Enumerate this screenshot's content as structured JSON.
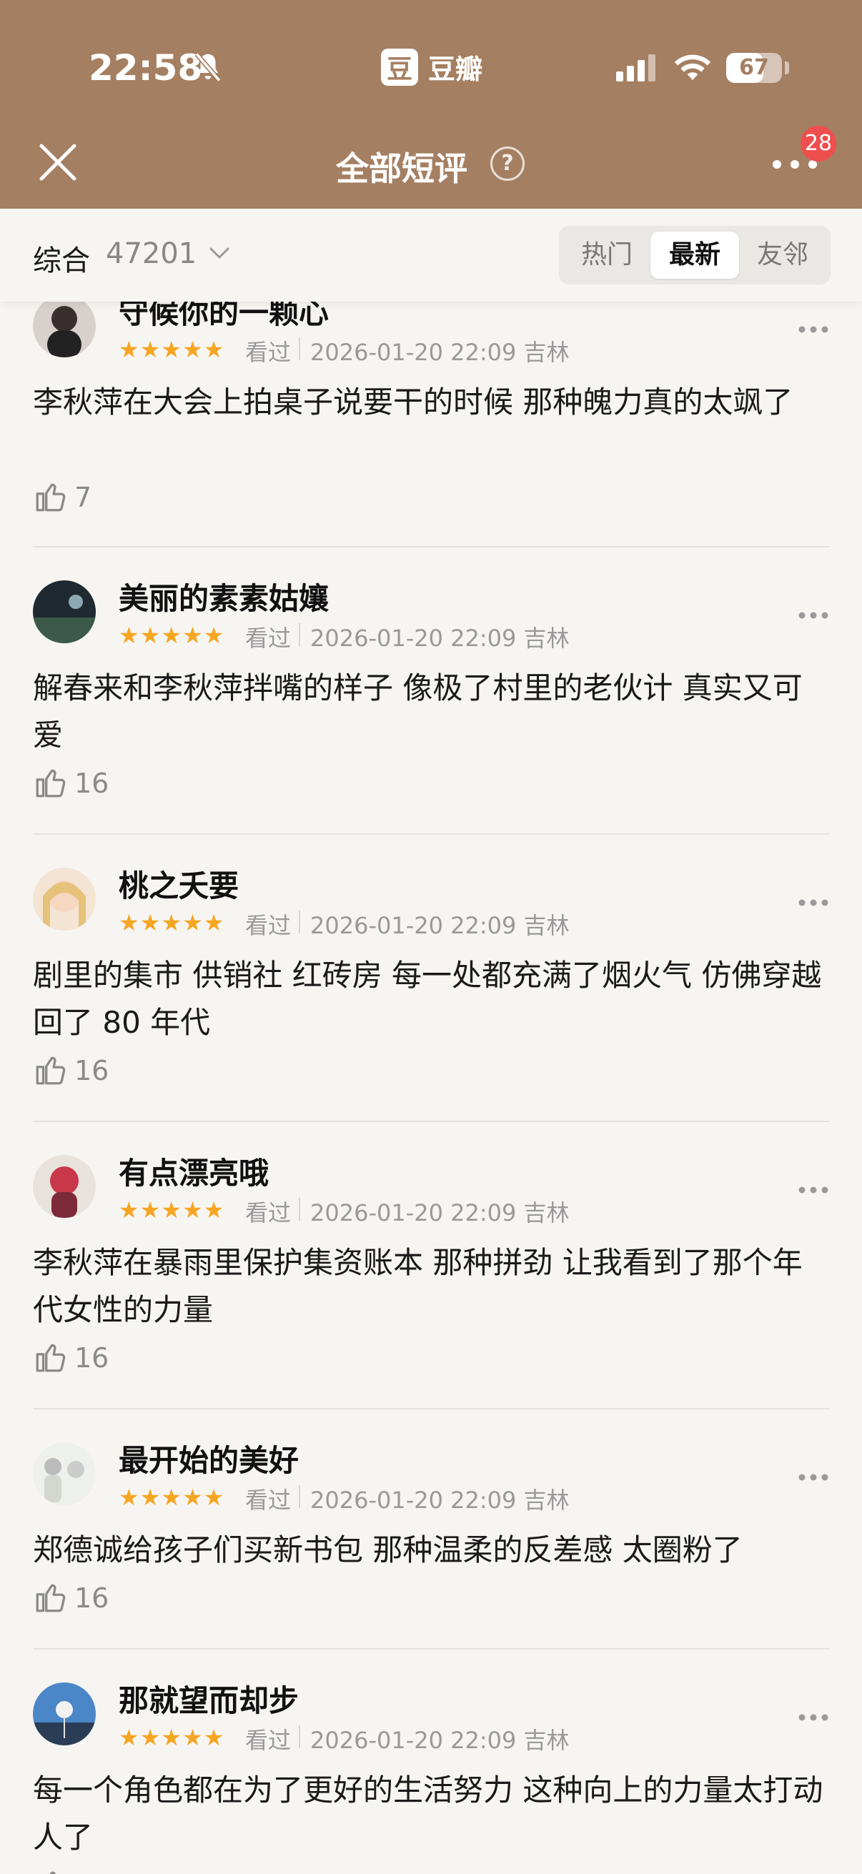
{
  "status_bar": {
    "time": "22:58",
    "battery": "67",
    "battery_level": 0.67
  },
  "app": {
    "brand_glyph": "豆",
    "brand_name": "豆瓣"
  },
  "nav": {
    "title": "全部短评",
    "help": "?",
    "badge": "28"
  },
  "filter": {
    "label": "综合",
    "count": "47201",
    "tabs": [
      "热门",
      "最新",
      "友邻"
    ],
    "active_tab": "最新"
  },
  "comments": [
    {
      "username": "守候你的一颗心",
      "rating": 5,
      "stars": "★★★★★",
      "watched": "看过",
      "meta": "2026-01-20 22:09 吉林",
      "text": "李秋萍在大会上拍桌子说要干的时候 那种魄力真的太飒了",
      "likes": "7"
    },
    {
      "username": "美丽的素素姑孃",
      "rating": 5,
      "stars": "★★★★★",
      "watched": "看过",
      "meta": "2026-01-20 22:09 吉林",
      "text": "解春来和李秋萍拌嘴的样子 像极了村里的老伙计 真实又可爱",
      "likes": "16"
    },
    {
      "username": "桃之夭要",
      "rating": 5,
      "stars": "★★★★★",
      "watched": "看过",
      "meta": "2026-01-20 22:09 吉林",
      "text": "剧里的集市 供销社 红砖房 每一处都充满了烟火气 仿佛穿越回了 80 年代",
      "likes": "16"
    },
    {
      "username": "有点漂亮哦",
      "rating": 5,
      "stars": "★★★★★",
      "watched": "看过",
      "meta": "2026-01-20 22:09 吉林",
      "text": "李秋萍在暴雨里保护集资账本 那种拼劲 让我看到了那个年代女性的力量",
      "likes": "16"
    },
    {
      "username": "最开始的美好",
      "rating": 5,
      "stars": "★★★★★",
      "watched": "看过",
      "meta": "2026-01-20 22:09 吉林",
      "text": "郑德诚给孩子们买新书包 那种温柔的反差感 太圈粉了",
      "likes": "16"
    },
    {
      "username": "那就望而却步",
      "rating": 5,
      "stars": "★★★★★",
      "watched": "看过",
      "meta": "2026-01-20 22:09 吉林",
      "text": "每一个角色都在为了更好的生活努力 这种向上的力量太打动人了",
      "likes": ""
    }
  ]
}
